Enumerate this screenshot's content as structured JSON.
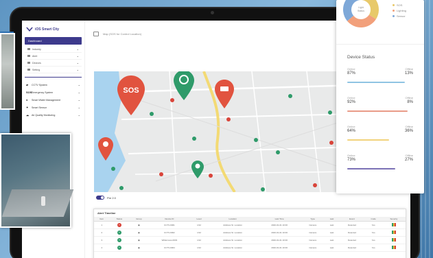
{
  "app": {
    "title": "iOS Smart City"
  },
  "topbar": {
    "breadcrumb": "Map (SOS for Control Location)"
  },
  "sidebar": {
    "active_label": "Dashboard",
    "sub_items": [
      {
        "label": "Industry"
      },
      {
        "label": "Alert"
      },
      {
        "label": "Devices"
      },
      {
        "label": "Setting"
      }
    ],
    "systems": [
      {
        "icon": "cctv-icon",
        "glyph": "▰",
        "label": "CCTV System"
      },
      {
        "icon": "sos-icon",
        "glyph": "SOS",
        "label": "Emergency System"
      },
      {
        "icon": "water-icon",
        "glyph": "●",
        "label": "Smart Water Management"
      },
      {
        "icon": "sensor-icon",
        "glyph": "✦",
        "label": "Smart Sensor"
      },
      {
        "icon": "cloud-icon",
        "glyph": "☁",
        "label": "Air Quality Monitoring"
      }
    ]
  },
  "map": {
    "sos_label": "SOS",
    "toggle_label": "Pre 2.0"
  },
  "alerts": {
    "title": "Alert Timeline",
    "columns": [
      "Item",
      "Status",
      "Group",
      "Device ID",
      "Level",
      "Location",
      "Last Time",
      "Type",
      "Last",
      "Event",
      "Code",
      "Severity"
    ],
    "rows": [
      {
        "item": "1",
        "status": "red",
        "group": "▣",
        "device": "CCTV-0001",
        "level": "1/12",
        "location": "Address St. Location",
        "last_time": "2020-01-01 10:00",
        "type": "Camera",
        "last": "Last",
        "event": "Detected",
        "code": "Yes"
      },
      {
        "item": "2",
        "status": "green",
        "group": "▣",
        "device": "CCTV-0002",
        "level": "1/12",
        "location": "Address St. Location",
        "last_time": "2020-01-01 10:00",
        "type": "Camera",
        "last": "Last",
        "event": "Detected",
        "code": "Yes"
      },
      {
        "item": "3",
        "status": "green",
        "group": "▣",
        "device": "Wilderness-0003",
        "level": "1/12",
        "location": "Address St. Location",
        "last_time": "2020-01-01 10:00",
        "type": "Camera",
        "last": "Last",
        "event": "Detected",
        "code": "Yes"
      },
      {
        "item": "4",
        "status": "green",
        "group": "▣",
        "device": "CCTV-0004",
        "level": "1/12",
        "location": "Address St. Location",
        "last_time": "2020-01-01 10:00",
        "type": "Camera",
        "last": "Last",
        "event": "Detected",
        "code": "Yes"
      }
    ]
  },
  "donut": {
    "center_label": "Light",
    "center_sub": "Status",
    "legend": [
      {
        "label": "SOS",
        "color": "#e8c96a"
      },
      {
        "label": "Lighting",
        "color": "#f2a07b"
      },
      {
        "label": "Sensor",
        "color": "#7ea8d8"
      }
    ],
    "segments": [
      {
        "color": "#e8c96a",
        "value": 0.34
      },
      {
        "color": "#f2a07b",
        "value": 0.3
      },
      {
        "color": "#7ea8d8",
        "value": 0.36
      }
    ]
  },
  "device_status": {
    "title": "Device Status",
    "online_label": "Online",
    "offline_label": "Offline",
    "items": [
      {
        "online": "87%",
        "offline": "13%",
        "color": "#8fc4e3"
      },
      {
        "online": "92%",
        "offline": "8%",
        "color": "#e99a87"
      },
      {
        "online": "64%",
        "offline": "36%",
        "color": "#f1d37c"
      },
      {
        "online": "73%",
        "offline": "27%",
        "color": "#7a70b5"
      }
    ]
  }
}
